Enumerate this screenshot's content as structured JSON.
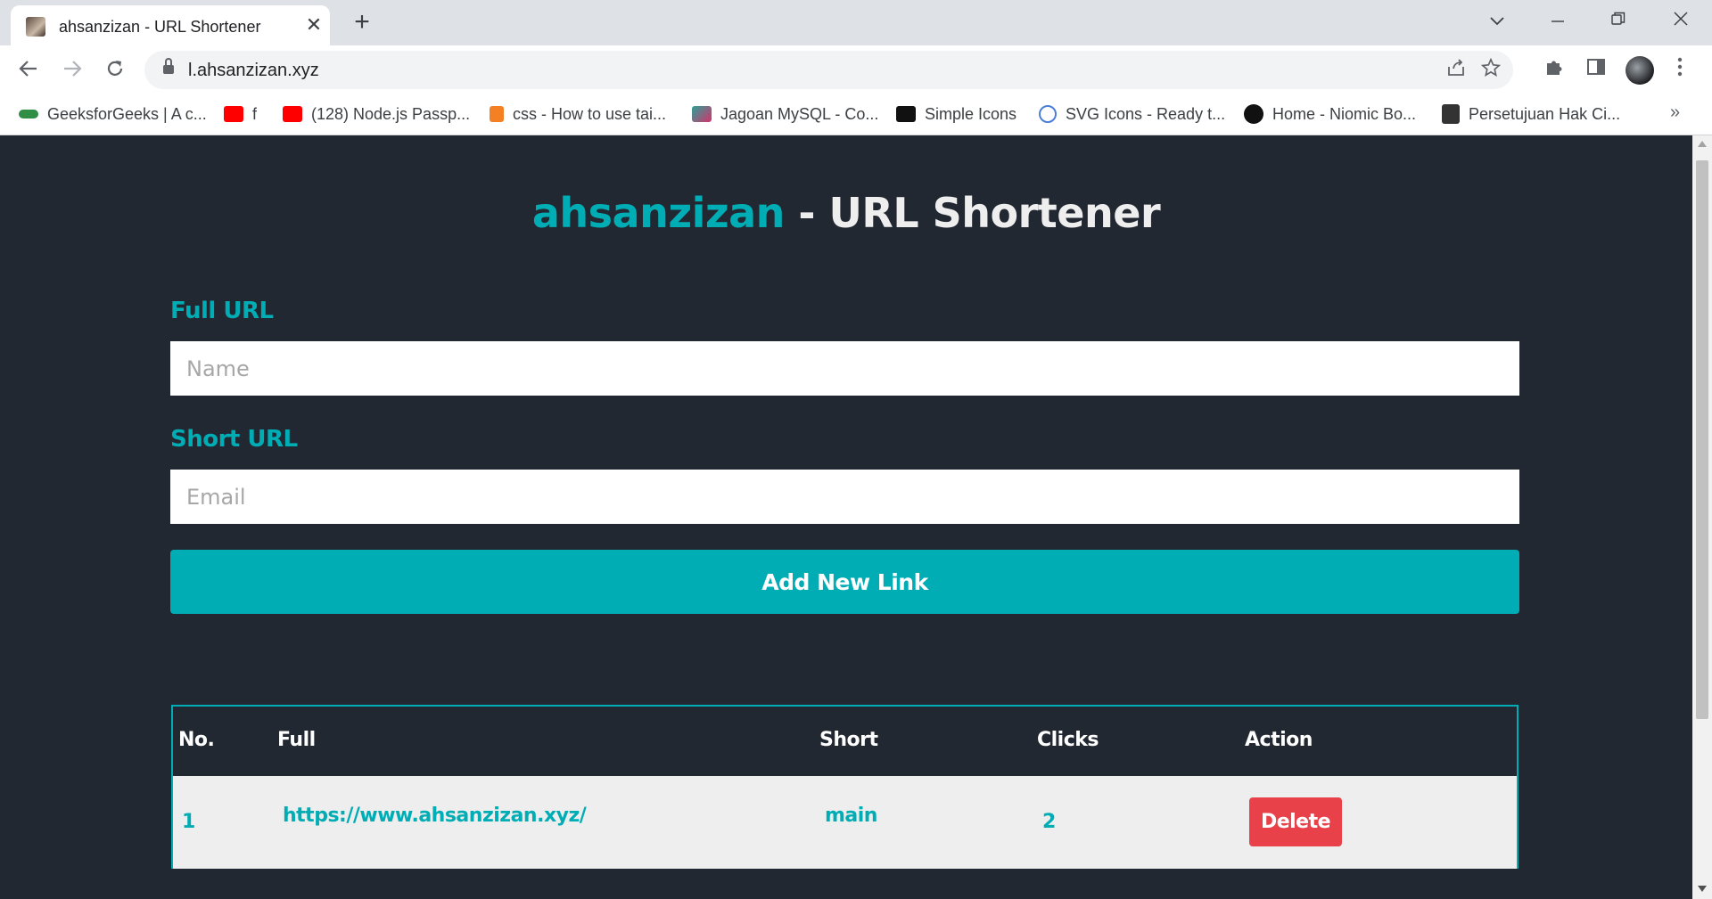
{
  "browser": {
    "tab_title": "ahsanzizan - URL Shortener",
    "tab_close": "✕",
    "new_tab": "+",
    "url": "l.ahsanzizan.xyz",
    "bookmarks": [
      {
        "label": "GeeksforGeeks | A c...",
        "icon": "geeksforgeeks-icon",
        "color": "#2f8d46"
      },
      {
        "label": "f",
        "icon": "youtube-icon",
        "color": "#ff0000"
      },
      {
        "label": "(128) Node.js Passp...",
        "icon": "youtube-icon",
        "color": "#ff0000"
      },
      {
        "label": "css - How to use tai...",
        "icon": "stackoverflow-icon",
        "color": "#f48024"
      },
      {
        "label": "Jagoan MySQL - Co...",
        "icon": "jagoan-icon",
        "color": "#d6336c"
      },
      {
        "label": "Simple Icons",
        "icon": "simple-icons-icon",
        "color": "#111111"
      },
      {
        "label": "SVG Icons - Ready t...",
        "icon": "dribbble-icon",
        "color": "#4a7fd6"
      },
      {
        "label": "Home - Niomic Bo...",
        "icon": "niomic-icon",
        "color": "#111111"
      },
      {
        "label": "Persetujuan Hak Ci...",
        "icon": "g-icon",
        "color": "#333333"
      }
    ],
    "more_bookmarks": "»"
  },
  "page": {
    "brand": "ahsanzizan",
    "title_rest": " - URL Shortener",
    "full_url_label": "Full URL",
    "full_url_placeholder": "Name",
    "short_url_label": "Short URL",
    "short_url_placeholder": "Email",
    "add_button": "Add New Link",
    "colors": {
      "accent": "#00adb5",
      "background": "#222831",
      "delete": "#e8414a"
    }
  },
  "table": {
    "headers": [
      "No.",
      "Full",
      "Short",
      "Clicks",
      "Action"
    ],
    "rows": [
      {
        "no": "1",
        "full": "https://www.ahsanzizan.xyz/",
        "short": "main",
        "clicks": "2",
        "action": "Delete"
      }
    ]
  }
}
